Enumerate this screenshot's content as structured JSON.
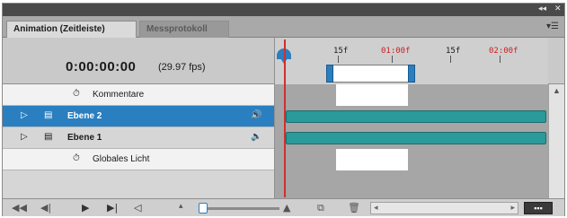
{
  "window": {
    "controls": [
      "◂◂",
      "✕"
    ]
  },
  "tabs": [
    {
      "label": "Animation (Zeitleiste)",
      "active": true
    },
    {
      "label": "Messprotokoll",
      "active": false
    }
  ],
  "panel_menu_icon": "panel-menu-icon",
  "header": {
    "timecode": "0:00:00:00",
    "fps": "(29.97 fps)"
  },
  "ruler": {
    "ticks": [
      {
        "label": "15f",
        "color": "#1a1a1a"
      },
      {
        "label": "01:00f",
        "color": "#cc2020"
      },
      {
        "label": "15f",
        "color": "#1a1a1a"
      },
      {
        "label": "02:00f",
        "color": "#cc2020"
      }
    ]
  },
  "layers": [
    {
      "label": "Kommentare",
      "icon": "stopwatch-icon",
      "selected": false,
      "type": "property"
    },
    {
      "label": "Ebene 2",
      "icon": "film-layer-icon",
      "selected": true,
      "type": "layer",
      "audio_icon": "speaker-icon"
    },
    {
      "label": "Ebene 1",
      "icon": "film-layer-icon",
      "selected": false,
      "type": "layer",
      "audio_icon": "speaker-icon"
    },
    {
      "label": "Globales Licht",
      "icon": "stopwatch-icon",
      "selected": false,
      "type": "property"
    }
  ],
  "colors": {
    "selection": "#2a7fc0",
    "track": "#2a9a9a",
    "playhead": "#d03030"
  },
  "footer": {
    "controls": [
      "⏮",
      "◀|",
      "▶",
      "|▶",
      "🔈"
    ],
    "zoom_small_icon": "mountain-small-icon",
    "zoom_large_icon": "mountain-large-icon"
  }
}
